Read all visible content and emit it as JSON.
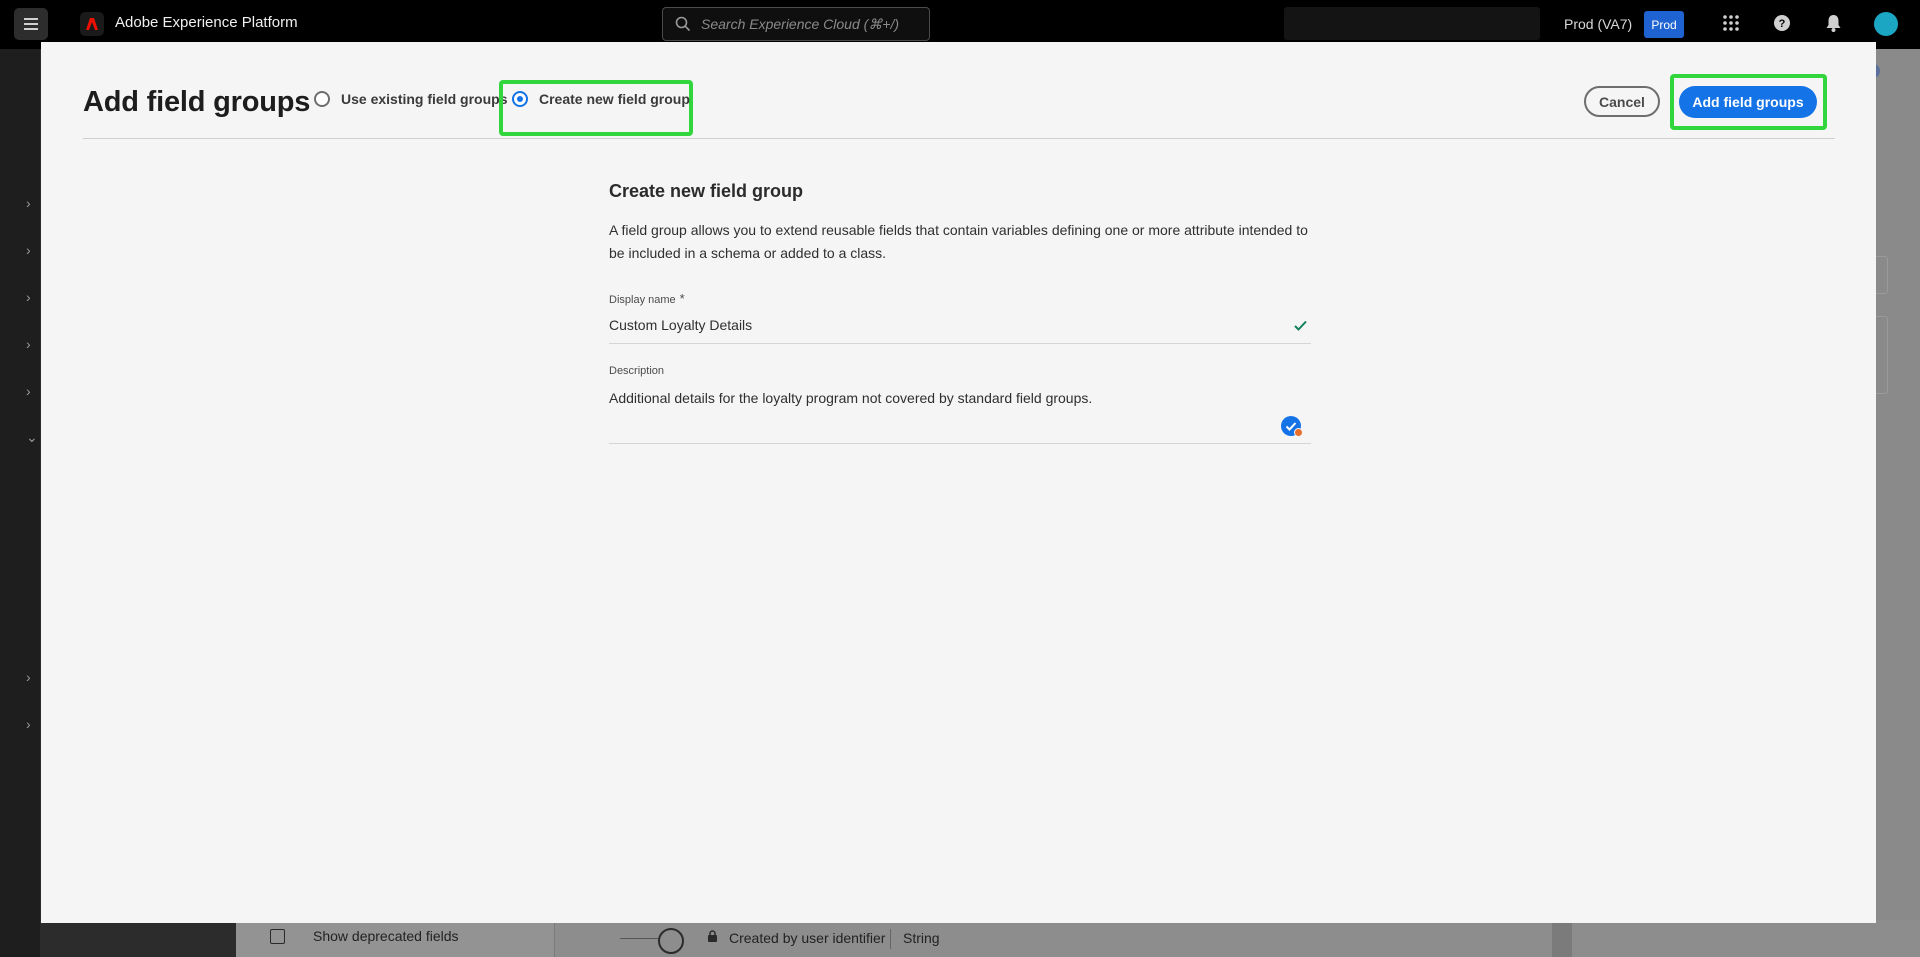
{
  "header": {
    "app_title": "Adobe Experience Platform",
    "search_placeholder": "Search Experience Cloud (⌘+/)",
    "sandbox": "Prod (VA7)",
    "sandbox_badge": "Prod",
    "icons": [
      "menu-icon",
      "adobe-logo-icon",
      "search-icon",
      "apps-grid-icon",
      "help-icon",
      "notifications-icon",
      "avatar"
    ]
  },
  "background": {
    "show_deprecated_label": "Show deprecated fields",
    "field_row": {
      "name": "Created by user identifier",
      "type": "String"
    }
  },
  "modal": {
    "title": "Add field groups",
    "options": [
      {
        "label": "Use existing field groups",
        "selected": false
      },
      {
        "label": "Create new field group",
        "selected": true
      }
    ],
    "cancel_label": "Cancel",
    "add_label": "Add field groups",
    "form": {
      "title": "Create new field group",
      "description": "A field group allows you to extend reusable fields that contain variables defining one or more attribute intended to be included in a schema or added to a class.",
      "display_name_label": "Display name",
      "required_marker": "*",
      "display_name_value": "Custom Loyalty Details",
      "description_label": "Description",
      "description_value": "Additional details for the loyalty program not covered by standard field groups."
    }
  },
  "colors": {
    "accent": "#1473e6",
    "highlight": "#31d63c",
    "valid": "#12805c"
  }
}
